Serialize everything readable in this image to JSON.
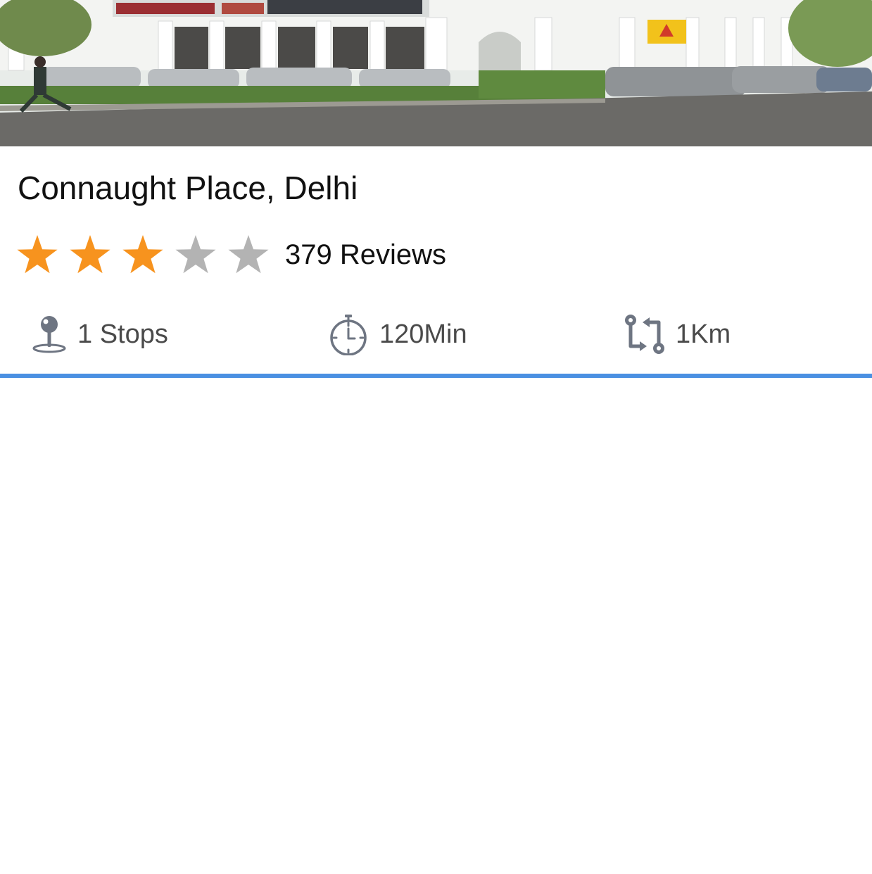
{
  "place": {
    "title": "Connaught Place, Delhi",
    "rating": 3,
    "rating_max": 5,
    "reviews_text": "379 Reviews"
  },
  "stats": {
    "stops": "1 Stops",
    "duration": "120Min",
    "distance": "1Km"
  },
  "icons": {
    "hero": "photo-of-connaught-place",
    "stops": "map-pin-icon",
    "duration": "stopwatch-icon",
    "distance": "route-icon"
  },
  "colors": {
    "star_filled": "#F7931E",
    "star_empty": "#B3B3B3",
    "icon": "#6E7582",
    "divider": "#4A90E2"
  }
}
